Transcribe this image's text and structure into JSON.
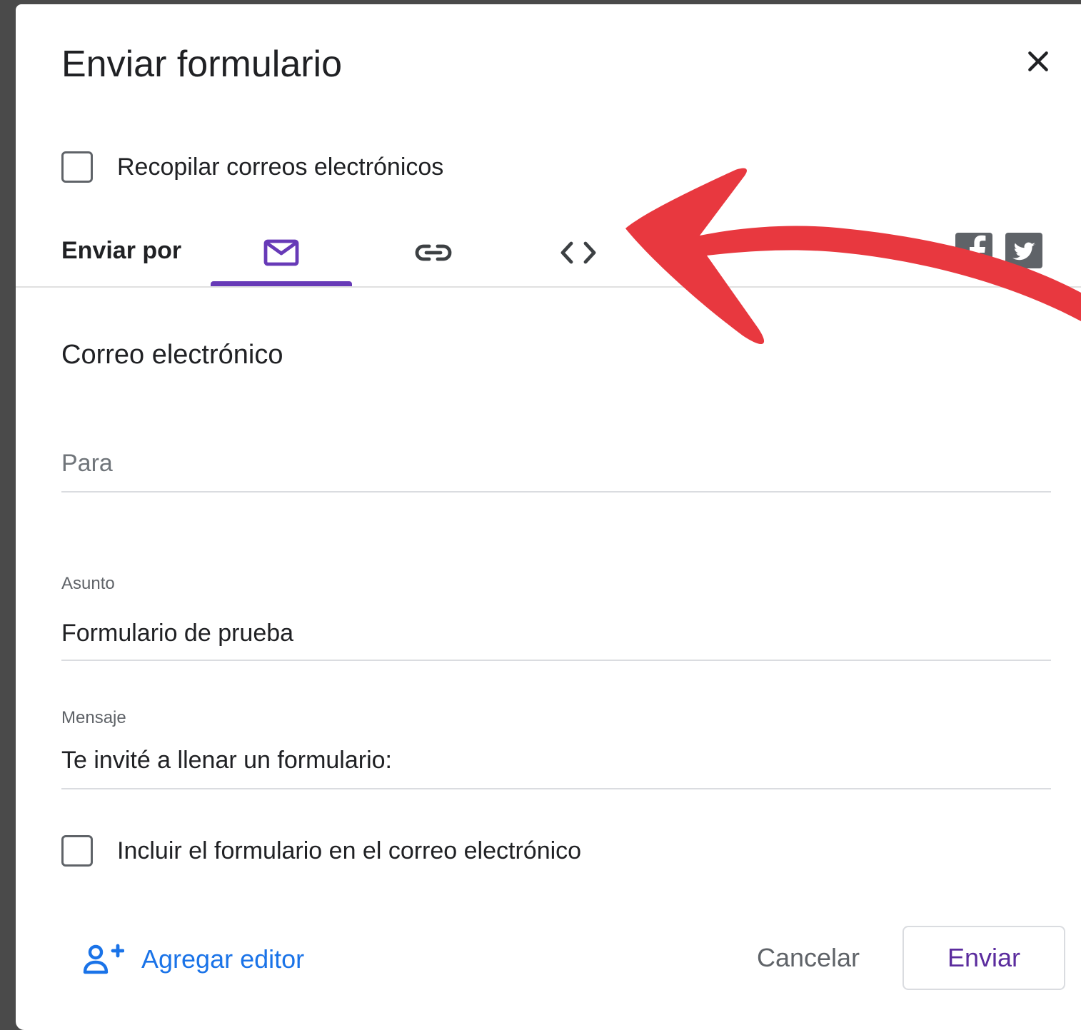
{
  "dialog": {
    "title": "Enviar formulario",
    "close_icon": "close-icon"
  },
  "collect_emails": {
    "label": "Recopilar correos electrónicos",
    "checked": false
  },
  "send_by": {
    "label": "Enviar por",
    "tabs": [
      {
        "icon": "mail-icon",
        "selected": true
      },
      {
        "icon": "link-icon",
        "selected": false
      },
      {
        "icon": "embed-code-icon",
        "selected": false
      }
    ],
    "social": [
      {
        "icon": "facebook-icon"
      },
      {
        "icon": "twitter-icon"
      }
    ]
  },
  "email_section": {
    "title": "Correo electrónico",
    "to": {
      "placeholder": "Para",
      "value": ""
    },
    "subject": {
      "label": "Asunto",
      "value": "Formulario de prueba"
    },
    "message": {
      "label": "Mensaje",
      "value": "Te invité a llenar un formulario:"
    },
    "include_form": {
      "label": "Incluir el formulario en el correo electrónico",
      "checked": false
    }
  },
  "footer": {
    "add_editor_label": "Agregar editor",
    "cancel_label": "Cancelar",
    "send_label": "Enviar"
  },
  "colors": {
    "accent": "#673ab7",
    "link": "#1a73e8",
    "annotation_arrow": "#e8383f"
  }
}
